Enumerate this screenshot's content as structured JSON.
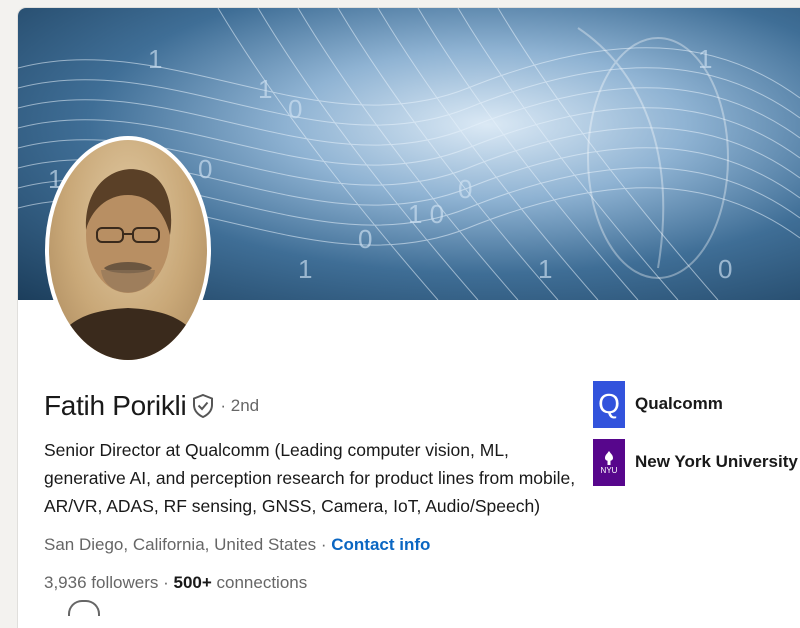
{
  "profile": {
    "name": "Fatih Porikli",
    "degree": "· 2nd",
    "headline": "Senior Director at Qualcomm (Leading computer vision, ML, generative AI, and perception research for product lines from mobile, AR/VR, ADAS, RF sensing, GNSS, Camera, IoT, Audio/Speech)",
    "location": "San Diego, California, United States",
    "separator": " · ",
    "contact_label": "Contact info",
    "followers_count": "3,936",
    "followers_label": " followers",
    "connections_prefix": " · ",
    "connections_count": "500+",
    "connections_label": " connections"
  },
  "organizations": [
    {
      "name": "Qualcomm",
      "logo_text": "Q",
      "logo_color": "#3253dc"
    },
    {
      "name": "New York University",
      "logo_text": "NYU",
      "logo_color": "#57068c"
    }
  ],
  "colors": {
    "link": "#0a66c2",
    "text": "#191919",
    "muted": "#666666"
  },
  "icons": {
    "verified": "shield-check-icon"
  }
}
